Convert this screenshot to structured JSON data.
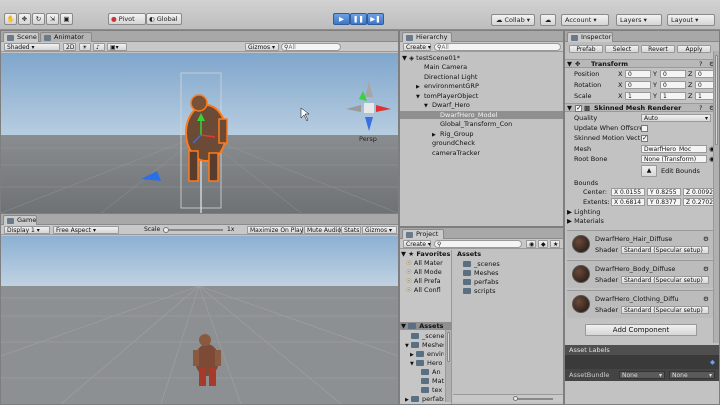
{
  "toolbar": {
    "pivot": "Pivot",
    "global": "Global",
    "collab": "Collab",
    "account": "Account",
    "layers": "Layers",
    "layout": "Layout"
  },
  "scene": {
    "tab": "Scene",
    "animator_tab": "Animator",
    "shaded": "Shaded",
    "mode2d": "2D",
    "gizmos": "Gizmos",
    "search_placeholder": "All",
    "persp": "Persp"
  },
  "game": {
    "tab": "Game",
    "display": "Display 1",
    "aspect": "Free Aspect",
    "scale_label": "Scale",
    "scale_value": "1x",
    "maximize": "Maximize On Play",
    "mute": "Mute Audio",
    "stats": "Stats",
    "gizmos": "Gizmos"
  },
  "hierarchy": {
    "tab": "Hierarchy",
    "create": "Create",
    "search": "All",
    "scene_name": "testScene01*",
    "items": [
      {
        "label": "Main Camera",
        "indent": 1
      },
      {
        "label": "Directional Light",
        "indent": 1
      },
      {
        "label": "environmentGRP",
        "indent": 1,
        "arrow": "▶"
      },
      {
        "label": "tomPlayerObject",
        "indent": 1,
        "arrow": "▼"
      },
      {
        "label": "Dwarf_Hero",
        "indent": 2,
        "arrow": "▼"
      },
      {
        "label": "DwarfHero_Model",
        "indent": 3,
        "selected": true
      },
      {
        "label": "Global_Transform_Con",
        "indent": 3
      },
      {
        "label": "Rig_Group",
        "indent": 3,
        "arrow": "▶"
      },
      {
        "label": "groundCheck",
        "indent": 2
      },
      {
        "label": "cameraTracker",
        "indent": 2
      }
    ]
  },
  "project": {
    "tab": "Project",
    "create": "Create",
    "favorites_title": "Favorites",
    "favorites": [
      "All Mater",
      "All Mode",
      "All Prefa",
      "All Confl"
    ],
    "assets_title": "Assets",
    "tree": [
      {
        "label": "_scenes",
        "indent": 1
      },
      {
        "label": "Meshes",
        "indent": 1,
        "arrow": "▼"
      },
      {
        "label": "enviro",
        "indent": 2,
        "arrow": "▶"
      },
      {
        "label": "Hero",
        "indent": 2,
        "arrow": "▼"
      },
      {
        "label": "An",
        "indent": 3
      },
      {
        "label": "Mat",
        "indent": 3
      },
      {
        "label": "tex",
        "indent": 3
      },
      {
        "label": "perfabs",
        "indent": 1,
        "arrow": "▶"
      }
    ],
    "breadcrumb": "Assets",
    "content": [
      "_scenes",
      "Meshes",
      "perfabs",
      "scripts"
    ]
  },
  "inspector": {
    "tab": "Inspector",
    "prefab": "Prefab",
    "select": "Select",
    "revert": "Revert",
    "apply": "Apply",
    "transform": {
      "title": "Transform",
      "position": {
        "label": "Position",
        "x": "0",
        "y": "0",
        "z": "0"
      },
      "rotation": {
        "label": "Rotation",
        "x": "0",
        "y": "0",
        "z": "0"
      },
      "scale": {
        "label": "Scale",
        "x": "1",
        "y": "1",
        "z": "1"
      }
    },
    "smr": {
      "title": "Skinned Mesh Renderer",
      "quality_label": "Quality",
      "quality_value": "Auto",
      "update_offscreen": "Update When Offscre",
      "skinned_motion": "Skinned Motion Vect",
      "mesh_label": "Mesh",
      "mesh_value": "DwarfHero_Moc",
      "root_bone_label": "Root Bone",
      "root_bone_value": "None (Transform)",
      "edit_bounds": "Edit Bounds",
      "bounds_label": "Bounds",
      "center_label": "Center:",
      "center": [
        "X 0.0155",
        "Y 0.8255",
        "Z 0.0092"
      ],
      "extents_label": "Extents:",
      "extents": [
        "X 0.6814",
        "Y 0.8377",
        "Z 0.2702"
      ],
      "lighting": "Lighting",
      "materials": "Materials"
    },
    "materials": [
      {
        "name": "DwarfHero_Hair_Diffuse",
        "shader_label": "Shader",
        "shader": "Standard (Specular setup)"
      },
      {
        "name": "DwarfHero_Body_Diffuse",
        "shader_label": "Shader",
        "shader": "Standard (Specular setup)"
      },
      {
        "name": "DwarfHero_Clothing_Diffu",
        "shader_label": "Shader",
        "shader": "Standard (Specular setup)"
      }
    ],
    "add_component": "Add Component",
    "asset_labels": "Asset Labels",
    "asset_bundle_label": "AssetBundle",
    "asset_bundle_value": "None",
    "asset_bundle_variant": "None"
  }
}
